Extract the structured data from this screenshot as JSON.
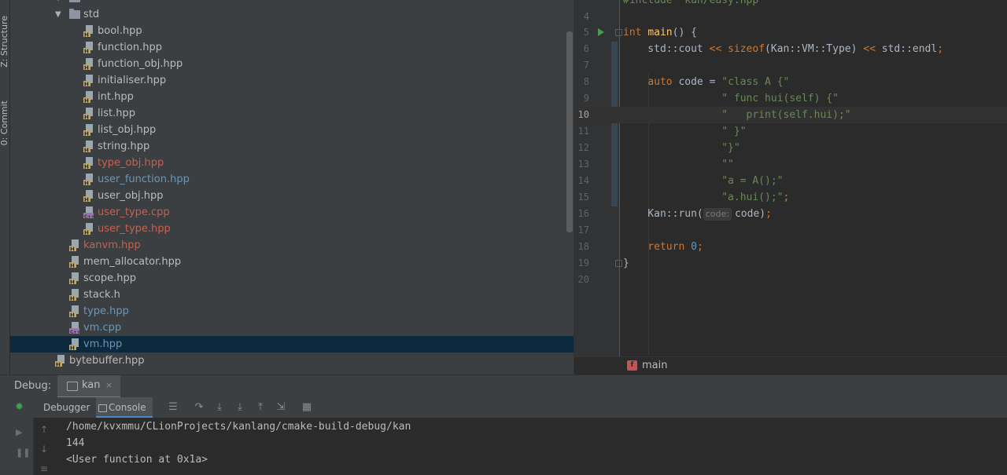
{
  "side_tabs": {
    "structure": "Z: Structure",
    "commit": "0: Commit"
  },
  "project_tree": {
    "folder": "std",
    "items": [
      {
        "name": "bool.hpp",
        "color": "#bbbbbb",
        "type": "header-icon"
      },
      {
        "name": "function.hpp",
        "color": "#bbbbbb",
        "type": "header-icon"
      },
      {
        "name": "function_obj.hpp",
        "color": "#bbbbbb",
        "type": "header-icon"
      },
      {
        "name": "initialiser.hpp",
        "color": "#bbbbbb",
        "type": "header-icon"
      },
      {
        "name": "int.hpp",
        "color": "#bbbbbb",
        "type": "header-icon"
      },
      {
        "name": "list.hpp",
        "color": "#bbbbbb",
        "type": "header-icon"
      },
      {
        "name": "list_obj.hpp",
        "color": "#bbbbbb",
        "type": "header-icon"
      },
      {
        "name": "string.hpp",
        "color": "#bbbbbb",
        "type": "header-icon"
      },
      {
        "name": "type_obj.hpp",
        "color": "#c7604f",
        "type": "header-icon"
      },
      {
        "name": "user_function.hpp",
        "color": "#6897bb",
        "type": "header-icon"
      },
      {
        "name": "user_obj.hpp",
        "color": "#bbbbbb",
        "type": "header-icon"
      },
      {
        "name": "user_type.cpp",
        "color": "#c7604f",
        "type": "cpp-icon"
      },
      {
        "name": "user_type.hpp",
        "color": "#c7604f",
        "type": "header-icon"
      }
    ],
    "vm_items": [
      {
        "name": "kanvm.hpp",
        "color": "#c7604f",
        "type": "header-icon"
      },
      {
        "name": "mem_allocator.hpp",
        "color": "#bbbbbb",
        "type": "header-icon"
      },
      {
        "name": "scope.hpp",
        "color": "#bbbbbb",
        "type": "header-icon"
      },
      {
        "name": "stack.h",
        "color": "#bbbbbb",
        "type": "header-icon"
      },
      {
        "name": "type.hpp",
        "color": "#6897bb",
        "type": "header-icon"
      },
      {
        "name": "vm.cpp",
        "color": "#6897bb",
        "type": "cpp-icon"
      },
      {
        "name": "vm.hpp",
        "color": "#6897bb",
        "type": "header-icon",
        "selected": true
      }
    ],
    "root_items": [
      {
        "name": "bytebuffer.hpp",
        "color": "#bbbbbb",
        "type": "header-icon"
      }
    ]
  },
  "editor": {
    "lines": [
      {
        "n": "5",
        "code": "int main() {"
      },
      {
        "n": "6",
        "code": "std::cout << sizeof(Kan::VM::Type) << std::endl;"
      },
      {
        "n": "7",
        "code": ""
      },
      {
        "n": "8",
        "code": "auto code = \"class A {\""
      },
      {
        "n": "9",
        "code": "\" func hui(self) {\""
      },
      {
        "n": "10",
        "code": "\"   print(self.hui);\""
      },
      {
        "n": "11",
        "code": "\" }\""
      },
      {
        "n": "12",
        "code": "\"}\""
      },
      {
        "n": "13",
        "code": "\"\""
      },
      {
        "n": "14",
        "code": "\"a = A();\""
      },
      {
        "n": "15",
        "code": "\"a.hui();\";"
      },
      {
        "n": "16",
        "code": "Kan::run(code);"
      },
      {
        "n": "17",
        "code": ""
      },
      {
        "n": "18",
        "code": "return 0;"
      },
      {
        "n": "19",
        "code": "}"
      },
      {
        "n": "20",
        "code": ""
      }
    ],
    "top_partial_line": {
      "n": "4"
    },
    "include_partial": "#include \"kan/easy.hpp\"",
    "current_line": "10",
    "param_hint": "code:",
    "breadcrumb_fn": "main",
    "breadcrumb_icon": "f"
  },
  "debug": {
    "title": "Debug:",
    "tab_label": "kan",
    "tab_close": "×",
    "subtab_debugger": "Debugger",
    "subtab_console": "Console",
    "console_lines": [
      "/home/kvxmmu/CLionProjects/kanlang/cmake-build-debug/kan",
      "144",
      "<User function at 0x1a>"
    ]
  }
}
